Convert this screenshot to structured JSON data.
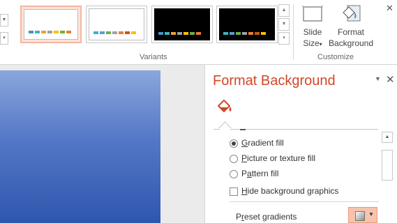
{
  "ribbon": {
    "variants_label": "Variants",
    "customize_label": "Customize",
    "slide_size": {
      "line1": "Slide",
      "line2": "Size",
      "arrow": "▾"
    },
    "format_background": {
      "line1": "Format",
      "line2": "Background"
    },
    "scroll_up": "▲",
    "scroll_down": "▼",
    "more": "▾",
    "close_glyph": "✕"
  },
  "variants": [
    {
      "style": "light",
      "selected": true,
      "swatches": [
        "#4a90c9",
        "#3bb3c4",
        "#f0a030",
        "#a0a0a0",
        "#ffc000",
        "#70ad47",
        "#ed7d31"
      ]
    },
    {
      "style": "light",
      "selected": false,
      "swatches": [
        "#3bb3c4",
        "#5b9bd5",
        "#70ad47",
        "#a0a0a0",
        "#ed7d31",
        "#c55a11",
        "#ffc000"
      ]
    },
    {
      "style": "dark",
      "selected": false,
      "swatches": [
        "#4a90c9",
        "#3bb3c4",
        "#f0a030",
        "#a0a0a0",
        "#ffc000",
        "#70ad47",
        "#ed7d31"
      ]
    },
    {
      "style": "dark",
      "selected": false,
      "swatches": [
        "#3bb3c4",
        "#5b9bd5",
        "#70ad47",
        "#a0a0a0",
        "#ed7d31",
        "#c55a11",
        "#ffc000"
      ]
    }
  ],
  "pane": {
    "title": "Format Background",
    "menu_glyph": "▼",
    "close_glyph": "✕",
    "options": [
      {
        "pre": "",
        "key": "G",
        "rest": "radient fill",
        "type": "radio",
        "checked": true
      },
      {
        "pre": "",
        "key": "P",
        "rest": "icture or texture fill",
        "type": "radio",
        "checked": false
      },
      {
        "pre": "P",
        "key": "a",
        "rest": "ttern fill",
        "type": "radio",
        "checked": false
      },
      {
        "pre": "",
        "key": "H",
        "rest": "ide background graphics",
        "type": "checkbox",
        "checked": false
      }
    ],
    "preset": {
      "pre": "P",
      "key": "r",
      "rest": "eset gradients",
      "arrow": "▼"
    }
  },
  "colors": {
    "accent": "#d24726",
    "selected_variant": "#fde3d8",
    "preset_button": "#f7c3ad"
  }
}
